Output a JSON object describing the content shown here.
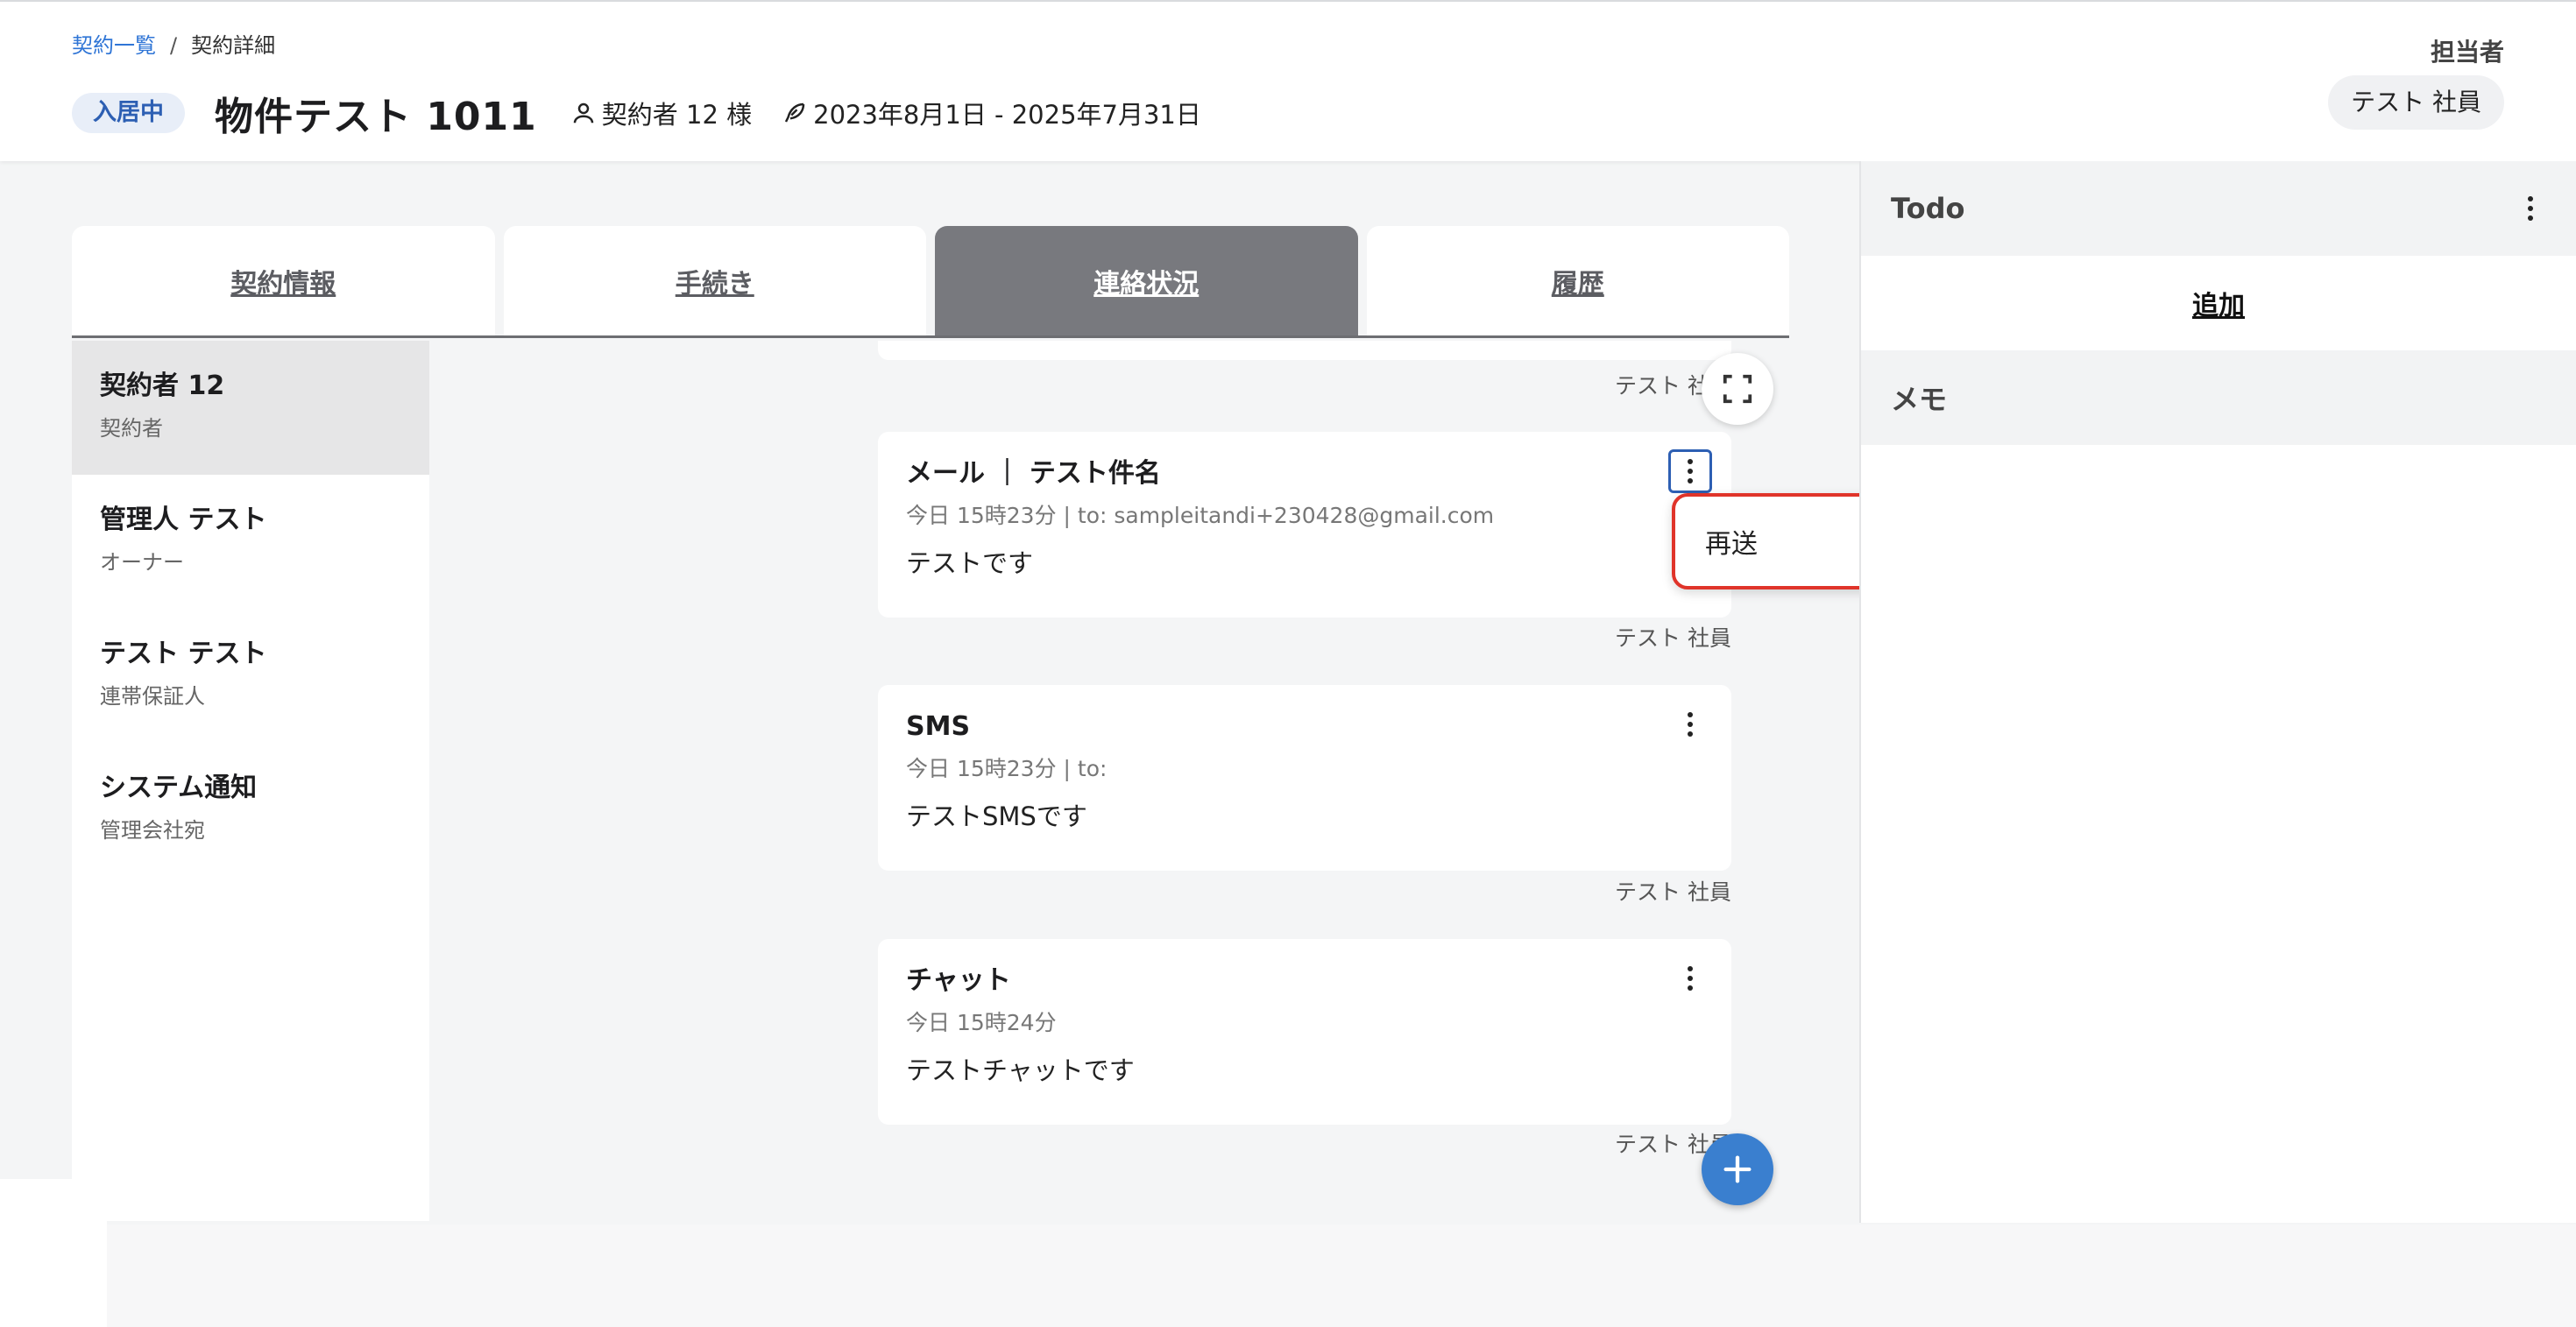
{
  "breadcrumb": {
    "parent": "契約一覧",
    "separator": "/",
    "current": "契約詳細"
  },
  "header": {
    "status_badge": "入居中",
    "title": "物件テスト 1011",
    "contractor": "契約者 12 様",
    "period": "2023年8月1日 - 2025年7月31日",
    "person_icon": "person-icon",
    "period_icon": "feather-icon",
    "assignee_label": "担当者",
    "assignee_name": "テスト 社員"
  },
  "tabs": [
    {
      "label": "契約情報",
      "active": false
    },
    {
      "label": "手続き",
      "active": false
    },
    {
      "label": "連絡状況",
      "active": true
    },
    {
      "label": "履歴",
      "active": false
    }
  ],
  "contacts": [
    {
      "name": "契約者 12",
      "role": "契約者",
      "active": true
    },
    {
      "name": "管理人 テスト",
      "role": "オーナー",
      "active": false
    },
    {
      "name": "テスト テスト",
      "role": "連帯保証人",
      "active": false
    },
    {
      "name": "システム通知",
      "role": "管理会社宛",
      "active": false
    }
  ],
  "feed": {
    "previous_author": "テスト 社員",
    "messages": [
      {
        "title": "メール ｜ テスト件名",
        "meta": "今日 15時23分  |  to: sampleitandi+230428@gmail.com",
        "body": "テストです",
        "author": "テスト 社員"
      },
      {
        "title": "SMS",
        "meta": "今日 15時23分  |  to:",
        "body": "テストSMSです",
        "author": "テスト 社員"
      },
      {
        "title": "チャット",
        "meta": "今日 15時24分",
        "body": "テストチャットです",
        "author": "テスト 社員"
      }
    ]
  },
  "dropdown": {
    "item": "再送"
  },
  "right_panel": {
    "todo_title": "Todo",
    "add_label": "追加",
    "memo_title": "メモ"
  },
  "icons": {
    "fullscreen": "fullscreen-icon",
    "add": "plus-icon",
    "menu": "kebab-icon"
  },
  "colors": {
    "accent": "#3a7fcf",
    "active_tab": "#78797e",
    "badge_bg": "#e8eef8",
    "badge_text": "#2d5fb3",
    "dropdown_border": "#e0342a",
    "link": "#2f75d6"
  }
}
